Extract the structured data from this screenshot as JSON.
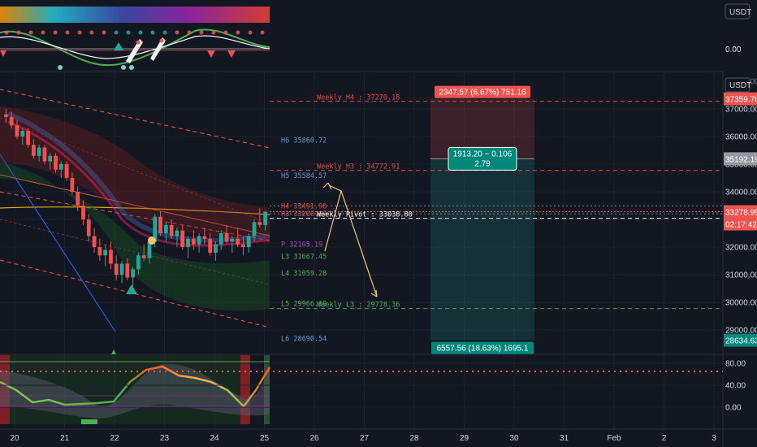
{
  "currency": "USDT",
  "colors": {
    "bg": "#131722",
    "up": "#26a69a",
    "down": "#ef5350",
    "grid": "#1e222d",
    "pivot_red": "#e04b4b",
    "pivot_blue": "#5b9bd5",
    "pivot_green": "#4caf50",
    "pivot_purple": "#ab47bc",
    "pivot_yellow": "#ffeb3b",
    "arrow": "#f0c26e"
  },
  "chart_data": {
    "type": "candlestick",
    "x_ticks": [
      "20",
      "21",
      "22",
      "23",
      "24",
      "25",
      "26",
      "27",
      "28",
      "29",
      "30",
      "31",
      "Feb",
      "2",
      "3"
    ],
    "price_axis": {
      "ticks": [
        "37000.00",
        "36000.00",
        "35000.00",
        "34000.00",
        "33000.00",
        "32000.00",
        "31000.00",
        "30000.00",
        "29000.00"
      ],
      "top_cut_label": "38000.00",
      "range": [
        28300,
        38200
      ]
    },
    "top_panel_axis": {
      "value": "0.00"
    },
    "oscillator_axis": {
      "ticks": [
        "80.00",
        "40.00",
        "0.00"
      ]
    },
    "price_tags": {
      "upper_target": "37359.76",
      "entry": "35192.19",
      "last_price": "33278.99",
      "countdown": "02:17:42",
      "lower_target": "28634.63"
    },
    "pivots_daily": [
      {
        "label": "H6 35860.72",
        "value": 35860.72
      },
      {
        "label": "H5 35584.57",
        "value": 34584.57
      },
      {
        "label": "H4 33491.98",
        "value": 33491.98
      },
      {
        "label": "H3 33200.67",
        "value": 33200.67
      },
      {
        "label": "P 32105.19",
        "value": 32105.19
      },
      {
        "label": "L3 31667.45",
        "value": 31667.45
      },
      {
        "label": "L4 31059.28",
        "value": 31059.28
      },
      {
        "label": "L5 29966.69",
        "value": 29966.69
      },
      {
        "label": "L6 28690.54",
        "value": 28690.54
      }
    ],
    "pivots_weekly": [
      {
        "label": "Weekly H4 : 37270.18",
        "value": 37270.18
      },
      {
        "label": "Weekly H3 : 34772.91",
        "value": 34772.91
      },
      {
        "label": "Weekly Pivot : 33038.88",
        "value": 33038.88
      },
      {
        "label": "Weekly L3 : 29778.36",
        "value": 29778.36
      }
    ],
    "position_tool": {
      "stop_label": "2347.57 (6.67%) 751.16",
      "entry_label_1": "1913.20 ~ 0.106",
      "entry_label_2": "2.79",
      "target_label": "6557.56 (18.63%) 1695.1",
      "stop": 37360,
      "entry": 35192,
      "target": 28634
    },
    "candles": [
      [
        36800,
        37000,
        36500,
        36700
      ],
      [
        36700,
        36900,
        36300,
        36400
      ],
      [
        36400,
        36600,
        35900,
        36000
      ],
      [
        36000,
        36300,
        35700,
        36200
      ],
      [
        36200,
        36300,
        35600,
        35700
      ],
      [
        35700,
        35900,
        35200,
        35300
      ],
      [
        35300,
        35700,
        35100,
        35600
      ],
      [
        35600,
        35700,
        35000,
        35100
      ],
      [
        35100,
        35400,
        34800,
        35300
      ],
      [
        35300,
        35400,
        34700,
        34800
      ],
      [
        34800,
        35100,
        34500,
        35000
      ],
      [
        35000,
        35100,
        34400,
        34500
      ],
      [
        34500,
        34700,
        33900,
        34000
      ],
      [
        34000,
        34200,
        33300,
        33500
      ],
      [
        33500,
        33700,
        32800,
        33000
      ],
      [
        33000,
        33200,
        32200,
        32400
      ],
      [
        32400,
        32700,
        31800,
        32000
      ],
      [
        32000,
        32300,
        31500,
        31700
      ],
      [
        31700,
        32100,
        31300,
        31900
      ],
      [
        31900,
        32200,
        31200,
        31400
      ],
      [
        31400,
        31700,
        30800,
        31000
      ],
      [
        31000,
        31500,
        30700,
        31400
      ],
      [
        31400,
        31600,
        30800,
        30900
      ],
      [
        30900,
        31300,
        30500,
        31200
      ],
      [
        31200,
        31800,
        31000,
        31700
      ],
      [
        31700,
        32100,
        31500,
        31600
      ],
      [
        31600,
        32300,
        31400,
        32200
      ],
      [
        32200,
        33200,
        32000,
        33100
      ],
      [
        33100,
        33300,
        32400,
        32500
      ],
      [
        32500,
        32900,
        32200,
        32800
      ],
      [
        32800,
        33000,
        32300,
        32400
      ],
      [
        32400,
        32700,
        32000,
        32600
      ],
      [
        32600,
        32800,
        31900,
        32000
      ],
      [
        32000,
        32400,
        31600,
        32300
      ],
      [
        32300,
        32600,
        31900,
        32100
      ],
      [
        32100,
        32500,
        31800,
        32400
      ],
      [
        32400,
        32700,
        32100,
        32300
      ],
      [
        32300,
        32500,
        31700,
        31800
      ],
      [
        31800,
        32200,
        31500,
        32100
      ],
      [
        32100,
        32600,
        31900,
        32500
      ],
      [
        32500,
        32800,
        32100,
        32200
      ],
      [
        32200,
        32400,
        31800,
        32300
      ],
      [
        32300,
        32700,
        32000,
        32100
      ],
      [
        32100,
        32400,
        31700,
        32000
      ],
      [
        32000,
        32500,
        31800,
        32400
      ],
      [
        32400,
        33000,
        32200,
        32900
      ],
      [
        32900,
        33400,
        32700,
        32800
      ],
      [
        32800,
        33300,
        32600,
        33279
      ]
    ]
  }
}
